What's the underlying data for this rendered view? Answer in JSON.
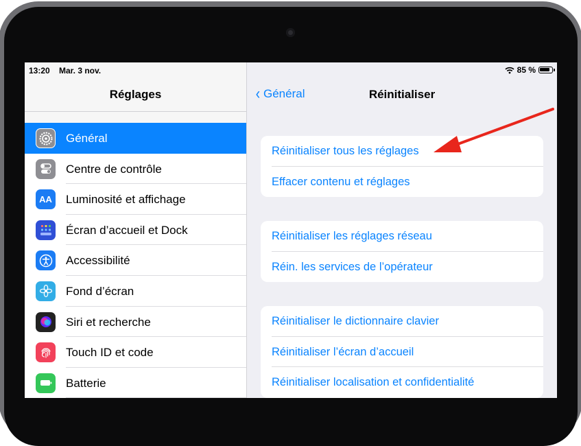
{
  "status": {
    "time": "13:20",
    "date": "Mar. 3 nov.",
    "battery": "85 %",
    "battery_level": 0.85
  },
  "sidebar": {
    "title": "Réglages",
    "items": [
      {
        "label": "Général",
        "icon": "gear-icon",
        "color": "#8e8e93",
        "selected": true
      },
      {
        "label": "Centre de contrôle",
        "icon": "toggles-icon",
        "color": "#8e8e93"
      },
      {
        "label": "Luminosité et affichage",
        "icon": "text-size-icon",
        "color": "#1b7cf4",
        "icon_text": "AA"
      },
      {
        "label": "Écran d’accueil et Dock",
        "icon": "app-grid-icon",
        "color": "#2f4fd6"
      },
      {
        "label": "Accessibilité",
        "icon": "accessibility-icon",
        "color": "#1b7cf4"
      },
      {
        "label": "Fond d’écran",
        "icon": "flower-icon",
        "color": "#32ade6"
      },
      {
        "label": "Siri et recherche",
        "icon": "siri-icon",
        "color": "#222222"
      },
      {
        "label": "Touch ID et code",
        "icon": "fingerprint-icon",
        "color": "#f2415a"
      },
      {
        "label": "Batterie",
        "icon": "battery-icon",
        "color": "#34c759"
      }
    ]
  },
  "detail": {
    "back_label": "Général",
    "title": "Réinitialiser",
    "groups": [
      [
        "Réinitialiser tous les réglages",
        "Effacer contenu et réglages"
      ],
      [
        "Réinitialiser les réglages réseau",
        "Réin. les services de l’opérateur"
      ],
      [
        "Réinitialiser le dictionnaire clavier",
        "Réinitialiser l’écran d’accueil",
        "Réinitialiser localisation et confidentialité"
      ]
    ]
  },
  "colors": {
    "accent": "#0a84ff",
    "annotation_arrow": "#e8261c"
  }
}
